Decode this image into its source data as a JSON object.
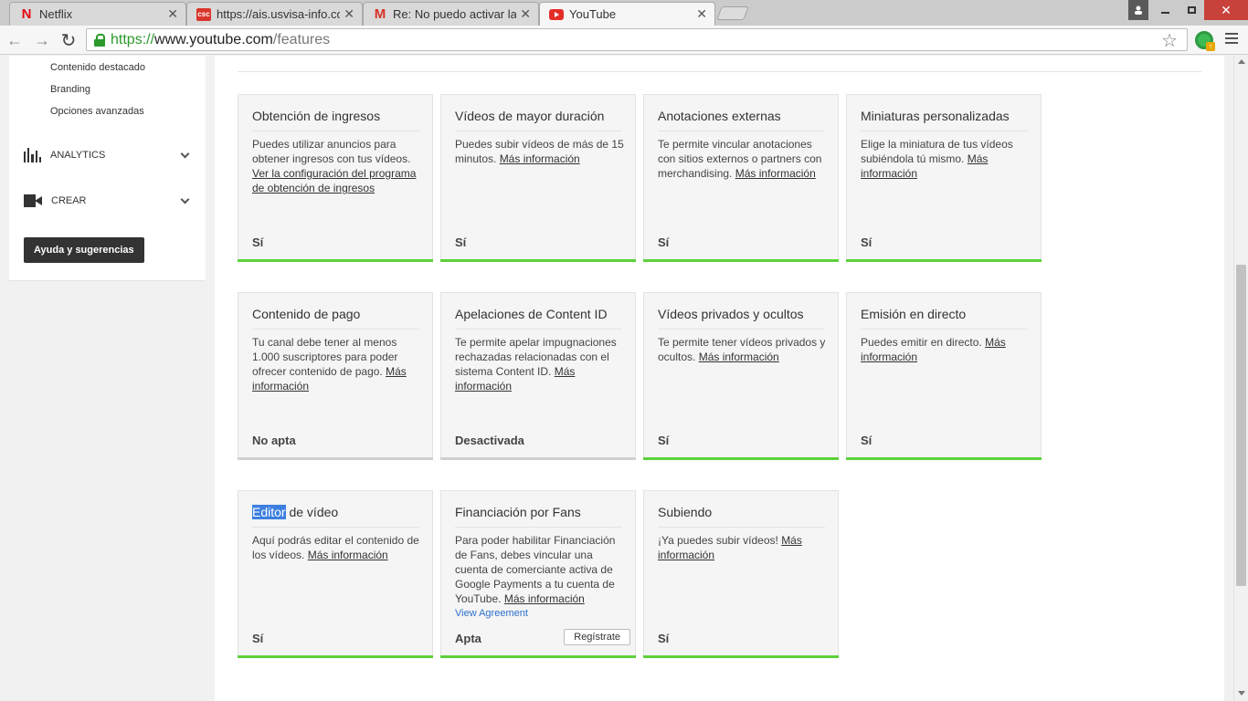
{
  "browser": {
    "tabs": [
      {
        "title": "Netflix",
        "favicon": "N"
      },
      {
        "title": "https://ais.usvisa-info.com",
        "favicon": "csc"
      },
      {
        "title": "Re: No puedo activar la fu",
        "favicon": "M"
      },
      {
        "title": "YouTube",
        "favicon": "youtube"
      }
    ],
    "url": {
      "scheme": "https://",
      "host": "www.youtube.com",
      "path": "/features"
    }
  },
  "sidebar": {
    "subitems": [
      "Contenido destacado",
      "Branding",
      "Opciones avanzadas"
    ],
    "sections": [
      {
        "label": "ANALYTICS",
        "icon": "analytics-icon"
      },
      {
        "label": "CREAR",
        "icon": "camera-icon"
      }
    ],
    "help_button": "Ayuda y sugerencias"
  },
  "features": [
    {
      "title": "Obtención de ingresos",
      "desc": "Puedes utilizar anuncios para obtener ingresos con tus vídeos. ",
      "link": "Ver la configuración del programa de obtención de ingresos",
      "status": "Sí",
      "enabled": true
    },
    {
      "title": "Vídeos de mayor duración",
      "desc": "Puedes subir vídeos de más de 15 minutos. ",
      "link": "Más información",
      "status": "Sí",
      "enabled": true
    },
    {
      "title": "Anotaciones externas",
      "desc": "Te permite vincular anotaciones con sitios externos o partners con merchandising. ",
      "link": "Más información",
      "status": "Sí",
      "enabled": true
    },
    {
      "title": "Miniaturas personalizadas",
      "desc": "Elige la miniatura de tus vídeos subiéndola tú mismo. ",
      "link": "Más información",
      "status": "Sí",
      "enabled": true
    },
    {
      "title": "Contenido de pago",
      "desc": "Tu canal debe tener al menos 1.000 suscriptores para poder ofrecer contenido de pago. ",
      "link": "Más información",
      "status": "No apta",
      "enabled": false
    },
    {
      "title": "Apelaciones de Content ID",
      "desc": "Te permite apelar impugnaciones rechazadas relacionadas con el sistema Content ID. ",
      "link": "Más información",
      "status": "Desactivada",
      "enabled": false
    },
    {
      "title": "Vídeos privados y ocultos",
      "desc": "Te permite tener vídeos privados y ocultos. ",
      "link": "Más información",
      "status": "Sí",
      "enabled": true
    },
    {
      "title": "Emisión en directo",
      "desc": "Puedes emitir en directo. ",
      "link": "Más información",
      "status": "Sí",
      "enabled": true
    },
    {
      "title_highlight": "Editor",
      "title": " de vídeo",
      "desc": "Aquí podrás editar el contenido de los vídeos. ",
      "link": "Más información",
      "status": "Sí",
      "enabled": true
    },
    {
      "title": "Financiación por Fans",
      "desc": "Para poder habilitar Financiación de Fans, debes vincular una cuenta de comerciante activa de Google Payments a tu cuenta de YouTube. ",
      "link": "Más información",
      "agreement": "View Agreement",
      "status": "Apta",
      "button": "Regístrate",
      "enabled": true
    },
    {
      "title": "Subiendo",
      "desc": "¡Ya puedes subir vídeos! ",
      "link": "Más información",
      "status": "Sí",
      "enabled": true
    }
  ],
  "colors": {
    "enabled_bar": "#5cd13a",
    "disabled_bar": "#cfcfcf",
    "url_green": "#2b9a2b"
  }
}
